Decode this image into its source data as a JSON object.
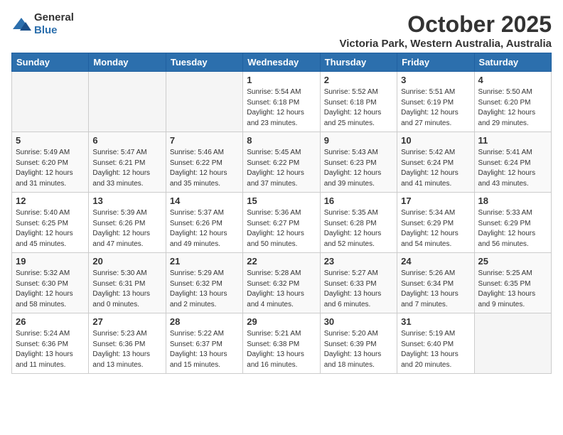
{
  "logo": {
    "general": "General",
    "blue": "Blue"
  },
  "header": {
    "month": "October 2025",
    "location": "Victoria Park, Western Australia, Australia"
  },
  "weekdays": [
    "Sunday",
    "Monday",
    "Tuesday",
    "Wednesday",
    "Thursday",
    "Friday",
    "Saturday"
  ],
  "weeks": [
    [
      {
        "day": "",
        "info": ""
      },
      {
        "day": "",
        "info": ""
      },
      {
        "day": "",
        "info": ""
      },
      {
        "day": "1",
        "info": "Sunrise: 5:54 AM\nSunset: 6:18 PM\nDaylight: 12 hours\nand 23 minutes."
      },
      {
        "day": "2",
        "info": "Sunrise: 5:52 AM\nSunset: 6:18 PM\nDaylight: 12 hours\nand 25 minutes."
      },
      {
        "day": "3",
        "info": "Sunrise: 5:51 AM\nSunset: 6:19 PM\nDaylight: 12 hours\nand 27 minutes."
      },
      {
        "day": "4",
        "info": "Sunrise: 5:50 AM\nSunset: 6:20 PM\nDaylight: 12 hours\nand 29 minutes."
      }
    ],
    [
      {
        "day": "5",
        "info": "Sunrise: 5:49 AM\nSunset: 6:20 PM\nDaylight: 12 hours\nand 31 minutes."
      },
      {
        "day": "6",
        "info": "Sunrise: 5:47 AM\nSunset: 6:21 PM\nDaylight: 12 hours\nand 33 minutes."
      },
      {
        "day": "7",
        "info": "Sunrise: 5:46 AM\nSunset: 6:22 PM\nDaylight: 12 hours\nand 35 minutes."
      },
      {
        "day": "8",
        "info": "Sunrise: 5:45 AM\nSunset: 6:22 PM\nDaylight: 12 hours\nand 37 minutes."
      },
      {
        "day": "9",
        "info": "Sunrise: 5:43 AM\nSunset: 6:23 PM\nDaylight: 12 hours\nand 39 minutes."
      },
      {
        "day": "10",
        "info": "Sunrise: 5:42 AM\nSunset: 6:24 PM\nDaylight: 12 hours\nand 41 minutes."
      },
      {
        "day": "11",
        "info": "Sunrise: 5:41 AM\nSunset: 6:24 PM\nDaylight: 12 hours\nand 43 minutes."
      }
    ],
    [
      {
        "day": "12",
        "info": "Sunrise: 5:40 AM\nSunset: 6:25 PM\nDaylight: 12 hours\nand 45 minutes."
      },
      {
        "day": "13",
        "info": "Sunrise: 5:39 AM\nSunset: 6:26 PM\nDaylight: 12 hours\nand 47 minutes."
      },
      {
        "day": "14",
        "info": "Sunrise: 5:37 AM\nSunset: 6:26 PM\nDaylight: 12 hours\nand 49 minutes."
      },
      {
        "day": "15",
        "info": "Sunrise: 5:36 AM\nSunset: 6:27 PM\nDaylight: 12 hours\nand 50 minutes."
      },
      {
        "day": "16",
        "info": "Sunrise: 5:35 AM\nSunset: 6:28 PM\nDaylight: 12 hours\nand 52 minutes."
      },
      {
        "day": "17",
        "info": "Sunrise: 5:34 AM\nSunset: 6:29 PM\nDaylight: 12 hours\nand 54 minutes."
      },
      {
        "day": "18",
        "info": "Sunrise: 5:33 AM\nSunset: 6:29 PM\nDaylight: 12 hours\nand 56 minutes."
      }
    ],
    [
      {
        "day": "19",
        "info": "Sunrise: 5:32 AM\nSunset: 6:30 PM\nDaylight: 12 hours\nand 58 minutes."
      },
      {
        "day": "20",
        "info": "Sunrise: 5:30 AM\nSunset: 6:31 PM\nDaylight: 13 hours\nand 0 minutes."
      },
      {
        "day": "21",
        "info": "Sunrise: 5:29 AM\nSunset: 6:32 PM\nDaylight: 13 hours\nand 2 minutes."
      },
      {
        "day": "22",
        "info": "Sunrise: 5:28 AM\nSunset: 6:32 PM\nDaylight: 13 hours\nand 4 minutes."
      },
      {
        "day": "23",
        "info": "Sunrise: 5:27 AM\nSunset: 6:33 PM\nDaylight: 13 hours\nand 6 minutes."
      },
      {
        "day": "24",
        "info": "Sunrise: 5:26 AM\nSunset: 6:34 PM\nDaylight: 13 hours\nand 7 minutes."
      },
      {
        "day": "25",
        "info": "Sunrise: 5:25 AM\nSunset: 6:35 PM\nDaylight: 13 hours\nand 9 minutes."
      }
    ],
    [
      {
        "day": "26",
        "info": "Sunrise: 5:24 AM\nSunset: 6:36 PM\nDaylight: 13 hours\nand 11 minutes."
      },
      {
        "day": "27",
        "info": "Sunrise: 5:23 AM\nSunset: 6:36 PM\nDaylight: 13 hours\nand 13 minutes."
      },
      {
        "day": "28",
        "info": "Sunrise: 5:22 AM\nSunset: 6:37 PM\nDaylight: 13 hours\nand 15 minutes."
      },
      {
        "day": "29",
        "info": "Sunrise: 5:21 AM\nSunset: 6:38 PM\nDaylight: 13 hours\nand 16 minutes."
      },
      {
        "day": "30",
        "info": "Sunrise: 5:20 AM\nSunset: 6:39 PM\nDaylight: 13 hours\nand 18 minutes."
      },
      {
        "day": "31",
        "info": "Sunrise: 5:19 AM\nSunset: 6:40 PM\nDaylight: 13 hours\nand 20 minutes."
      },
      {
        "day": "",
        "info": ""
      }
    ]
  ]
}
